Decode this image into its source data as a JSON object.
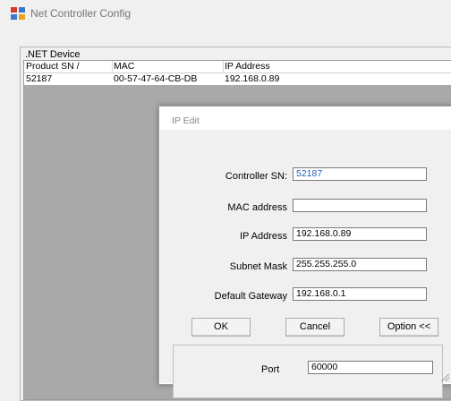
{
  "window": {
    "title": "Net Controller Config",
    "icon": "app-network-icon"
  },
  "group": {
    "title": ".NET Device"
  },
  "device_list": {
    "columns": [
      "Product SN /",
      "MAC",
      "IP Address"
    ],
    "rows": [
      [
        "52187",
        "00-57-47-64-CB-DB",
        "192.168.0.89"
      ]
    ]
  },
  "dialog": {
    "title": "IP Edit",
    "fields": {
      "controller_sn": {
        "label": "Controller SN:",
        "value": "52187"
      },
      "mac_address": {
        "label": "MAC address",
        "value": ""
      },
      "ip_address": {
        "label": "IP Address",
        "value": "192.168.0.89"
      },
      "subnet_mask": {
        "label": "Subnet Mask",
        "value": "255.255.255.0"
      },
      "default_gateway": {
        "label": "Default Gateway",
        "value": "192.168.0.1"
      }
    },
    "buttons": {
      "ok": "OK",
      "cancel": "Cancel",
      "option": "Option <<"
    },
    "port": {
      "label": "Port",
      "value": "60000"
    }
  },
  "colors": {
    "sn_value": "#1f5fbf",
    "list_background": "#a9a9a9"
  }
}
